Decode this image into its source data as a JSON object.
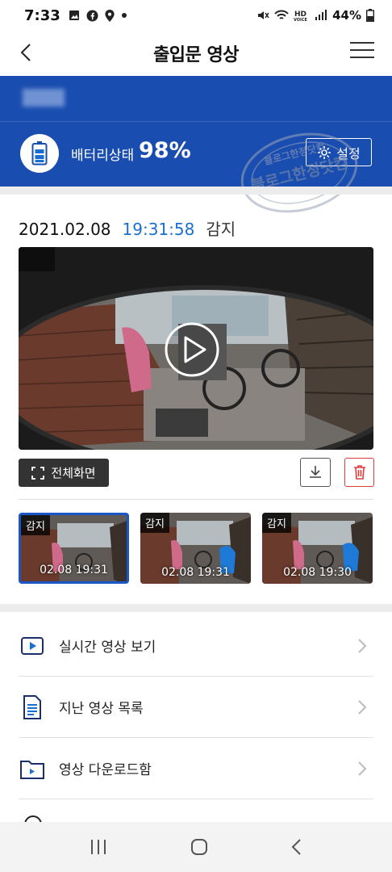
{
  "status_bar": {
    "time": "7:33",
    "battery": "44%",
    "icons": [
      "gallery-icon",
      "facebook-icon",
      "location-icon",
      "dot-icon",
      "mute-icon",
      "wifi-icon",
      "hd-voice-icon",
      "signal-icon",
      "battery-icon"
    ]
  },
  "app_bar": {
    "title": "출입문 영상"
  },
  "banner": {
    "battery_label": "배터리상태",
    "battery_value": "98%",
    "settings_label": "설정",
    "bg_color": "#1a4db0"
  },
  "watermark": {
    "line1": "블로그한정닷컴",
    "line2": "블로그한정닷컴"
  },
  "event": {
    "date": "2021.02.08",
    "time": "19:31:58",
    "type": "감지"
  },
  "player": {
    "fullscreen_label": "전체화면"
  },
  "thumbnails": [
    {
      "tag": "감지",
      "timestamp": "02.08 19:31",
      "selected": true
    },
    {
      "tag": "감지",
      "timestamp": "02.08 19:31",
      "selected": false
    },
    {
      "tag": "감지",
      "timestamp": "02.08 19:30",
      "selected": false
    }
  ],
  "menu": [
    {
      "label": "실시간 영상 보기",
      "icon": "play-icon"
    },
    {
      "label": "지난 영상 목록",
      "icon": "document-icon"
    },
    {
      "label": "영상 다운로드함",
      "icon": "folder-icon"
    }
  ],
  "colors": {
    "accent_blue": "#1a6fd1",
    "delete_red": "#e03c3c"
  }
}
